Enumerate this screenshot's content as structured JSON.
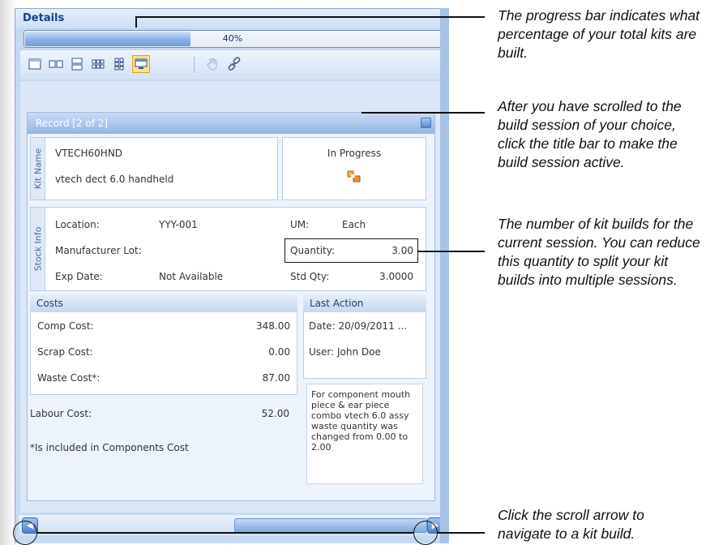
{
  "panel": {
    "title": "Details",
    "progress": {
      "value": 0.4,
      "label": "40%"
    }
  },
  "toolbar": {
    "icons": [
      "single-panel-icon",
      "two-columns-icon",
      "two-rows-icon",
      "grid-3x2-icon",
      "grid-2x3-icon",
      "card-view-icon",
      "pan-hand-icon",
      "link-icon"
    ]
  },
  "record": {
    "title": "Record [2 of 2]",
    "kit_name_label": "Kit Name",
    "kit_code": "VTECH60HND",
    "kit_desc": "vtech dect 6.0 handheld",
    "status": "In Progress",
    "stock_info_label": "Stock Info",
    "location_label": "Location:",
    "location_value": "YYY-001",
    "manufacturer_lot_label": "Manufacturer Lot:",
    "exp_date_label": "Exp Date:",
    "exp_date_value": "Not Available",
    "um_label": "UM:",
    "um_value": "Each",
    "quantity_label": "Quantity:",
    "quantity_value": "3.00",
    "std_qty_label": "Std Qty:",
    "std_qty_value": "3.0000",
    "costs": {
      "title": "Costs",
      "comp_label": "Comp Cost:",
      "comp_value": "348.00",
      "scrap_label": "Scrap Cost:",
      "scrap_value": "0.00",
      "waste_label": "Waste Cost*:",
      "waste_value": "87.00",
      "labour_label": "Labour Cost:",
      "labour_value": "52.00",
      "footnote": "*Is included in Components Cost"
    },
    "last_action": {
      "title": "Last Action",
      "date": "Date: 20/09/2011 ...",
      "user": "User: John Doe",
      "note": "For component mouth piece & ear piece combo vtech 6.0 assy waste quantity was changed from 0.00 to 2.00"
    }
  },
  "callouts": {
    "progress": "The progress bar indicates what percentage of your total kits are built.",
    "title_bar": "After you have scrolled to the build session of your choice, click the title bar to make the build session active.",
    "quantity": "The number of kit builds for the current session. You can reduce this quantity to split your kit builds into multiple sessions.",
    "scroll": "Click the scroll arrow to navigate to a kit build."
  }
}
